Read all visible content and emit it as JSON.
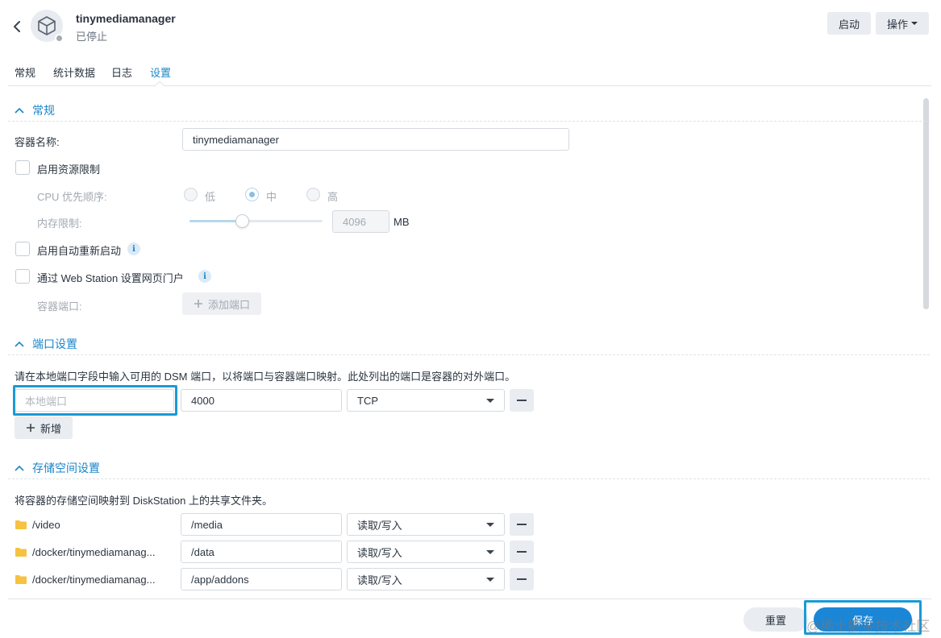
{
  "header": {
    "app_name": "tinymediamanager",
    "status": "已停止",
    "start_label": "启动",
    "ops_label": "操作"
  },
  "tabs": [
    {
      "label": "常规"
    },
    {
      "label": "统计数据"
    },
    {
      "label": "日志"
    },
    {
      "label": "设置"
    }
  ],
  "general": {
    "title": "常规",
    "container_name_label": "容器名称:",
    "container_name_value": "tinymediamanager",
    "resource_limit_label": "启用资源限制",
    "cpu_priority_label": "CPU 优先顺序:",
    "cpu_options": [
      "低",
      "中",
      "高"
    ],
    "cpu_selected": "中",
    "memory_limit_label": "内存限制:",
    "memory_value": "4096",
    "memory_unit": "MB",
    "memory_slider_fraction": 0.4,
    "auto_restart_label": "启用自动重新启动",
    "web_station_label": "通过 Web Station 设置网页门户",
    "container_port_label": "容器端口:",
    "add_port_label": "添加端口"
  },
  "ports": {
    "title": "端口设置",
    "description": "请在本地端口字段中输入可用的 DSM 端口，以将端口与容器端口映射。此处列出的端口是容器的对外端口。",
    "local_port_placeholder": "本地端口",
    "container_port_value": "4000",
    "protocol": "TCP",
    "add_label": "新增"
  },
  "storage": {
    "title": "存储空间设置",
    "description": "将容器的存储空间映射到 DiskStation 上的共享文件夹。",
    "rows": [
      {
        "folder": "/video",
        "mount": "/media",
        "permission": "读取/写入"
      },
      {
        "folder": "/docker/tinymediamanag...",
        "mount": "/data",
        "permission": "读取/写入"
      },
      {
        "folder": "/docker/tinymediamanag...",
        "mount": "/app/addons",
        "permission": "读取/写入"
      }
    ]
  },
  "footer": {
    "reset_label": "重置",
    "save_label": "保存",
    "watermark": "@稀土掘金技术社区"
  },
  "colors": {
    "accent": "#1b86c8",
    "highlight": "#1a9ad6",
    "save_button": "#1b86d6"
  }
}
